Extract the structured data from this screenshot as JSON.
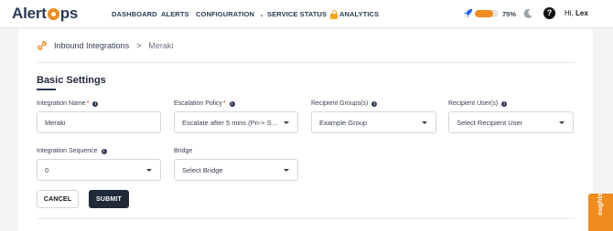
{
  "brand": {
    "name_prefix": "Alert",
    "name_suffix": "ps",
    "accent_color": "#f08c1e",
    "navy_color": "#2b3a55"
  },
  "nav": {
    "dashboard": "DASHBOARD",
    "alerts": "ALERTS",
    "configuration": "CONFIGURATION",
    "service_status": "SERVICE STATUS",
    "analytics": "ANALYTICS"
  },
  "header": {
    "progress_percent": 75,
    "progress_label": "75%",
    "greeting_prefix": "Hi,",
    "user_name": "Lex",
    "icons": [
      "rocket-icon",
      "moon-icon",
      "help-icon",
      "lock-icon"
    ]
  },
  "breadcrumb": {
    "parent": "Inbound Integrations",
    "separator": ">",
    "current": "Meraki"
  },
  "section": {
    "title": "Basic Settings"
  },
  "form": {
    "integration_name": {
      "label": "Integration Name",
      "required": "*",
      "value": "Meraki"
    },
    "escalation_policy": {
      "label": "Escalation Policy",
      "required": "*",
      "value": "Escalate after 5 mins (Pri-> Sec..."
    },
    "recipient_groups": {
      "label": "Recipient Groups(s)",
      "value": "Example Group"
    },
    "recipient_users": {
      "label": "Recipient User(s)",
      "placeholder": "Select Recipient User"
    },
    "integration_sequence": {
      "label": "Integration Sequence",
      "value": "0"
    },
    "bridge": {
      "label": "Bridge",
      "placeholder": "Select Bridge"
    }
  },
  "buttons": {
    "cancel": "CANCEL",
    "submit": "SUBMIT"
  },
  "side_tab": {
    "label": "oughts"
  }
}
